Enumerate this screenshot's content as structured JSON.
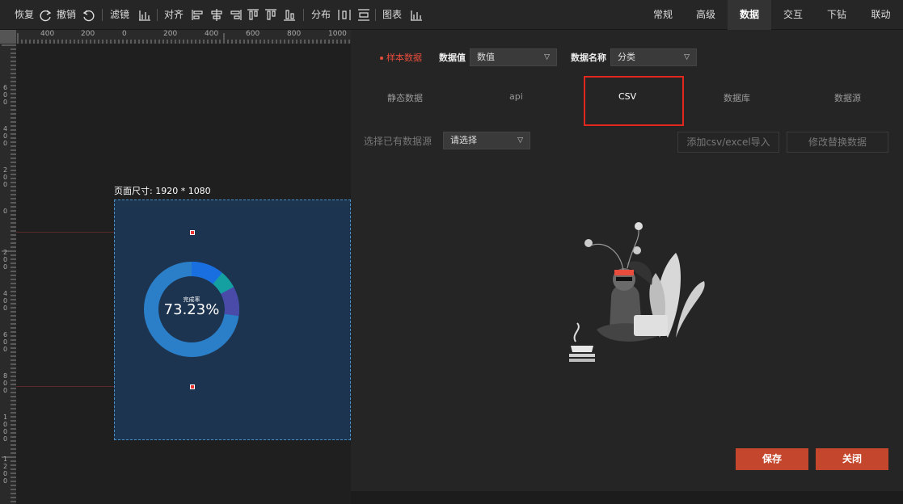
{
  "toolbar": {
    "restore": "恢复",
    "undo": "撤销",
    "filter": "滤镜",
    "align": "对齐",
    "distribute": "分布",
    "chart": "图表"
  },
  "top_tabs": [
    "常规",
    "高级",
    "数据",
    "交互",
    "下钻",
    "联动"
  ],
  "active_top_tab": "数据",
  "ruler": {
    "h_labels": [
      "400",
      "200",
      "0",
      "200",
      "400",
      "600",
      "800",
      "1000"
    ],
    "v_labels": [
      "600",
      "400",
      "200",
      "0",
      "200",
      "400",
      "600",
      "800",
      "1000",
      "1200"
    ]
  },
  "canvas": {
    "page_size_label": "页面尺寸: 1920 * 1080",
    "donut_center_label": "完成率",
    "donut_value": "73.23%",
    "donut_percent": 73.23
  },
  "panel": {
    "sample_data_label": "样本数据",
    "data_value_label": "数据值",
    "data_value_selected": "数值",
    "data_name_label": "数据名称",
    "data_name_selected": "分类",
    "source_tabs": [
      "静态数据",
      "api",
      "CSV",
      "数据库",
      "数据源"
    ],
    "active_source_tab": "CSV",
    "choose_source_label": "选择已有数据源",
    "choose_source_placeholder": "请选择",
    "add_csv_button": "添加csv/excel导入",
    "modify_data_button": "修改替换数据",
    "save_button": "保存",
    "close_button": "关闭"
  },
  "colors": {
    "accent": "#c4462c",
    "highlight": "#e0281e",
    "donut_main": "#2a7fc8",
    "donut_blue": "#1a6fe0",
    "donut_teal": "#14a0a0",
    "donut_purple": "#4a4aa8"
  },
  "icons": [
    "redo-icon",
    "undo-icon",
    "bar-chart-icon",
    "align-left-icon",
    "align-center-icon",
    "align-right-icon",
    "align-top-icon",
    "align-middle-icon",
    "align-bottom-icon",
    "distribute-h-icon",
    "distribute-v-icon",
    "chart-icon",
    "caret-down-icon",
    "empty-state-illustration"
  ]
}
